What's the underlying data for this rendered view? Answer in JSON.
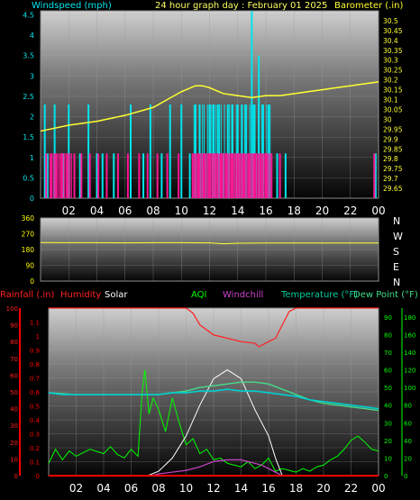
{
  "colors": {
    "windspeed": "#00e5ee",
    "gust": "#ff1493",
    "barometer": "#ffff33",
    "direction": "#ffff33",
    "rain": "#ff0000",
    "humidity": "#ff2020",
    "solar": "#ffffff",
    "aqi": "#00ff00",
    "windchill": "#cc44cc",
    "temperature": "#00d0d0",
    "dewpoint": "#44dd88",
    "accent_green": "#00ff00",
    "axis_cyan": "#00ffff",
    "axis_yellow": "#ffff00",
    "axis_red": "#ff0000"
  },
  "header": {
    "windspeed_label": "Windspeed (mph)",
    "title": "24 hour graph day : February 01 2025",
    "barometer_label": "Barometer (.in)"
  },
  "legend3": {
    "rainfall": "Rainfall (.in)",
    "humidity": "Humidity",
    "solar": "Solar",
    "aqi": "AQI",
    "windchill": "Windchill",
    "temperature": "Temperature (°F)",
    "dewpoint": "Dew Point (°F)"
  },
  "chart_data": [
    {
      "type": "bar",
      "panel": "wind",
      "x_ticks": [
        "02",
        "04",
        "06",
        "08",
        "10",
        "12",
        "14",
        "16",
        "18",
        "20",
        "22",
        "00"
      ],
      "x_range_hours": [
        0,
        24
      ],
      "ylabel_left": "Windspeed (mph)",
      "ylim_left": [
        0,
        4.6
      ],
      "yticks_left": [
        "0",
        "0.5",
        "1",
        "1.5",
        "2",
        "2.5",
        "3",
        "3.5",
        "4",
        "4.5"
      ],
      "ylabel_right": "Barometer (.in)",
      "ylim_right": [
        29.6,
        30.55
      ],
      "yticks_right": [
        "29.65",
        "29.7",
        "29.75",
        "29.8",
        "29.85",
        "29.9",
        "29.95",
        "30",
        "30.05",
        "30.1",
        "30.15",
        "30.2",
        "30.25",
        "30.3",
        "30.35",
        "30.4",
        "30.45",
        "30.5"
      ],
      "series": [
        {
          "role": "windspeed",
          "pattern": "sparse spikes 1.1–2.3 mph, dense 11:00–16:30, peak 4.6 at ~15:00",
          "hours": [
            0.3,
            0.5,
            1.0,
            1.6,
            2.0,
            2.8,
            3.4,
            4.0,
            4.4,
            5.2,
            6.4,
            7.3,
            7.8,
            8.6,
            9.2,
            10.0,
            10.6,
            11.0,
            11.3,
            11.6,
            12.0,
            12.3,
            12.6,
            13.0,
            13.3,
            13.6,
            14.0,
            14.3,
            14.6,
            15.0,
            15.2,
            15.5,
            15.8,
            16.2,
            16.8,
            17.4,
            23.8
          ],
          "values": [
            2.3,
            1.1,
            2.3,
            1.1,
            2.3,
            1.1,
            2.3,
            1.1,
            1.1,
            1.1,
            2.3,
            1.1,
            2.3,
            1.1,
            2.3,
            2.3,
            1.1,
            2.3,
            2.3,
            1.1,
            2.3,
            2.3,
            2.3,
            1.1,
            2.3,
            2.3,
            2.3,
            2.3,
            2.3,
            4.6,
            2.3,
            3.5,
            2.3,
            2.3,
            1.1,
            1.1,
            1.1
          ]
        },
        {
          "role": "gust",
          "hours": [
            0.4,
            0.7,
            1.1,
            1.5,
            1.9,
            2.4,
            2.9,
            3.5,
            4.1,
            4.7,
            5.5,
            6.2,
            7.0,
            7.6,
            8.3,
            9.0,
            9.8,
            10.8,
            11.2,
            11.6,
            12.0,
            12.4,
            12.8,
            13.2,
            13.6,
            14.0,
            14.4,
            14.8,
            15.2,
            15.6,
            16.0,
            16.4,
            17.0,
            23.7
          ],
          "values": [
            1.1,
            1.1,
            1.1,
            1.1,
            1.1,
            1.1,
            1.1,
            1.1,
            1.1,
            1.1,
            1.1,
            1.1,
            1.1,
            1.1,
            1.1,
            1.1,
            1.1,
            1.1,
            1.1,
            1.1,
            1.1,
            1.1,
            1.1,
            1.1,
            1.1,
            1.1,
            1.1,
            1.1,
            1.1,
            1.1,
            1.1,
            1.1,
            1.1,
            1.1
          ]
        },
        {
          "role": "barometer",
          "hours": [
            0,
            2,
            4,
            6,
            8,
            9,
            10,
            11,
            11.5,
            12,
            13,
            14,
            15,
            16,
            17,
            18,
            19,
            20,
            21,
            22,
            23,
            24
          ],
          "values": [
            29.94,
            29.97,
            29.99,
            30.02,
            30.06,
            30.1,
            30.14,
            30.17,
            30.17,
            30.16,
            30.13,
            30.12,
            30.11,
            30.12,
            30.12,
            30.13,
            30.14,
            30.15,
            30.16,
            30.17,
            30.18,
            30.19
          ]
        }
      ]
    },
    {
      "type": "line",
      "panel": "wind-direction",
      "x_range_hours": [
        0,
        24
      ],
      "ylim": [
        0,
        360
      ],
      "yticks": [
        "0",
        "90",
        "180",
        "270",
        "360"
      ],
      "compass_labels": [
        "N",
        "W",
        "S",
        "E",
        "N"
      ],
      "series": [
        {
          "role": "direction",
          "hours": [
            0,
            2,
            4,
            6,
            8,
            10,
            12,
            13,
            14,
            16,
            18,
            20,
            22,
            24
          ],
          "values": [
            220,
            219,
            219,
            218,
            219,
            219,
            218,
            213,
            216,
            217,
            217,
            217,
            217,
            217
          ]
        }
      ]
    },
    {
      "type": "line",
      "panel": "weather",
      "x_ticks": [
        "02",
        "04",
        "06",
        "08",
        "10",
        "12",
        "14",
        "16",
        "18",
        "20",
        "22",
        "00"
      ],
      "x_range_hours": [
        0,
        24
      ],
      "ylim_rain": [
        0,
        1.2
      ],
      "yticks_rain": [
        "0",
        "0.1",
        "0.2",
        "0.3",
        "0.4",
        "0.5",
        "0.6",
        "0.7",
        "0.8",
        "0.9",
        "1",
        "1.1"
      ],
      "yticks_humidity": [
        "0",
        "10",
        "20",
        "30",
        "40",
        "50",
        "60",
        "70",
        "80",
        "90",
        "100"
      ],
      "ylim_temp": [
        0,
        95
      ],
      "yticks_temp": [
        "0",
        "10",
        "20",
        "30",
        "40",
        "50",
        "60",
        "70",
        "80",
        "90"
      ],
      "yticks_aqi": [
        "0",
        "20",
        "40",
        "60",
        "80",
        "100",
        "120",
        "140",
        "160",
        "180"
      ],
      "series": [
        {
          "role": "humidity",
          "hours": [
            0,
            8,
            10,
            10.5,
            11,
            12,
            13,
            14,
            15,
            15.3,
            16,
            16.5,
            17,
            17.5,
            18,
            24
          ],
          "values": [
            100,
            100,
            100,
            97,
            90,
            84,
            82,
            80,
            79,
            77,
            80,
            82,
            90,
            98,
            100,
            100
          ]
        },
        {
          "role": "temperature",
          "hours": [
            0,
            1,
            2,
            3,
            4,
            5,
            6,
            7,
            8,
            9,
            10,
            11,
            12,
            13,
            14,
            15,
            16,
            17,
            18,
            19,
            20,
            21,
            22,
            23,
            24
          ],
          "values": [
            47,
            46,
            46,
            46,
            46,
            46,
            46,
            46,
            46,
            47,
            47,
            48,
            48,
            49,
            48,
            48,
            47,
            46,
            45,
            43,
            42,
            41,
            40,
            39,
            38
          ]
        },
        {
          "role": "dewpoint",
          "hours": [
            0,
            2,
            4,
            6,
            8,
            9,
            10,
            11,
            12,
            13,
            14,
            15,
            16,
            17,
            18,
            19,
            20,
            21,
            22,
            23,
            24
          ],
          "values": [
            47,
            46,
            46,
            46,
            46,
            47,
            48,
            50,
            51,
            52,
            53,
            53,
            52,
            49,
            46,
            43,
            41,
            40,
            39,
            38,
            37
          ]
        },
        {
          "role": "aqi",
          "hours": [
            0,
            0.5,
            1,
            1.5,
            2,
            3,
            4,
            4.5,
            5,
            5.5,
            6,
            6.5,
            6.8,
            7,
            7.3,
            7.6,
            8,
            8.5,
            9,
            9.5,
            10,
            10.5,
            11,
            11.5,
            12,
            12.5,
            13,
            13.5,
            14,
            14.5,
            15,
            15.5,
            16,
            16.5,
            17,
            17.5,
            18,
            18.5,
            19,
            19.5,
            20,
            20.5,
            21,
            21.5,
            22,
            22.5,
            23,
            23.5,
            24
          ],
          "values": [
            14,
            30,
            18,
            28,
            22,
            30,
            25,
            33,
            24,
            20,
            30,
            22,
            95,
            120,
            70,
            88,
            75,
            50,
            88,
            60,
            35,
            42,
            25,
            30,
            18,
            20,
            14,
            12,
            10,
            16,
            8,
            12,
            20,
            5,
            8,
            6,
            4,
            8,
            5,
            10,
            12,
            18,
            22,
            30,
            40,
            45,
            38,
            30,
            28
          ]
        },
        {
          "role": "solar",
          "hours": [
            0,
            7.2,
            8,
            9,
            10,
            11,
            12,
            13,
            14,
            15,
            16,
            16.5,
            17,
            18,
            24
          ],
          "values": [
            0,
            0,
            5,
            20,
            45,
            80,
            110,
            120,
            110,
            75,
            45,
            20,
            0,
            0,
            0
          ]
        },
        {
          "role": "windchill",
          "hours": [
            0,
            7.5,
            8,
            9,
            10,
            11,
            12,
            13,
            14,
            15,
            15.5,
            16,
            16.5,
            17,
            18,
            24
          ],
          "values": [
            0,
            0,
            1,
            2,
            3,
            5,
            8,
            9,
            9,
            7,
            6,
            4,
            2,
            0,
            0,
            0
          ]
        },
        {
          "role": "rain",
          "hours": [
            0,
            24
          ],
          "values": [
            0,
            0
          ]
        }
      ]
    }
  ]
}
